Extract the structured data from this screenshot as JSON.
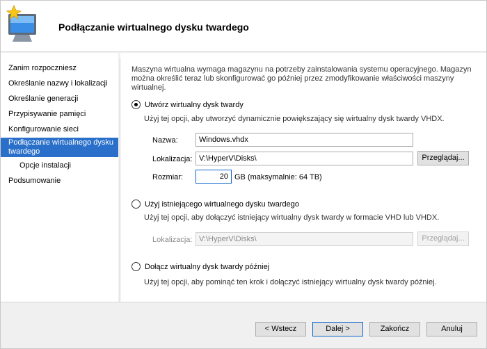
{
  "header": {
    "title": "Podłączanie wirtualnego dysku twardego",
    "icon": "wizard-monitor-star-icon"
  },
  "sidebar": {
    "items": [
      {
        "label": "Zanim rozpoczniesz"
      },
      {
        "label": "Określanie nazwy i lokalizacji"
      },
      {
        "label": "Określanie generacji"
      },
      {
        "label": "Przypisywanie pamięci"
      },
      {
        "label": "Konfigurowanie sieci"
      },
      {
        "label": "Podłączanie wirtualnego dysku twardego",
        "active": true
      },
      {
        "label": "Opcje instalacji"
      },
      {
        "label": "Podsumowanie"
      }
    ]
  },
  "main": {
    "description": "Maszyna wirtualna wymaga magazynu na potrzeby zainstalowania systemu operacyjnego. Magazyn można określić teraz lub skonfigurować go później przez zmodyfikowanie właściwości maszyny wirtualnej.",
    "create": {
      "label": "Utwórz wirtualny dysk twardy",
      "selected": true,
      "hint": "Użyj tej opcji, aby utworzyć dynamicznie powiększający się wirtualny dysk twardy VHDX.",
      "name_label": "Nazwa:",
      "name_value": "Windows.vhdx",
      "location_label": "Lokalizacja:",
      "location_value": "V:\\HyperV\\Disks\\",
      "browse_label": "Przeglądaj...",
      "size_label": "Rozmiar:",
      "size_value": "20",
      "size_unit": "GB (maksymalnie: 64 TB)"
    },
    "existing": {
      "label": "Użyj istniejącego wirtualnego dysku twardego",
      "selected": false,
      "hint": "Użyj tej opcji, aby dołączyć istniejący wirtualny dysk twardy w formacie VHD lub VHDX.",
      "location_label": "Lokalizacja:",
      "location_value": "V:\\HyperV\\Disks\\",
      "browse_label": "Przeglądaj..."
    },
    "later": {
      "label": "Dołącz wirtualny dysk twardy później",
      "selected": false,
      "hint": "Użyj tej opcji, aby pominąć ten krok i dołączyć istniejący wirtualny dysk twardy później."
    }
  },
  "footer": {
    "back_label": "< Wstecz",
    "next_label": "Dalej >",
    "finish_label": "Zakończ",
    "cancel_label": "Anuluj"
  },
  "colors": {
    "accent": "#2a6fc9",
    "focus_border": "#0a62c8"
  }
}
